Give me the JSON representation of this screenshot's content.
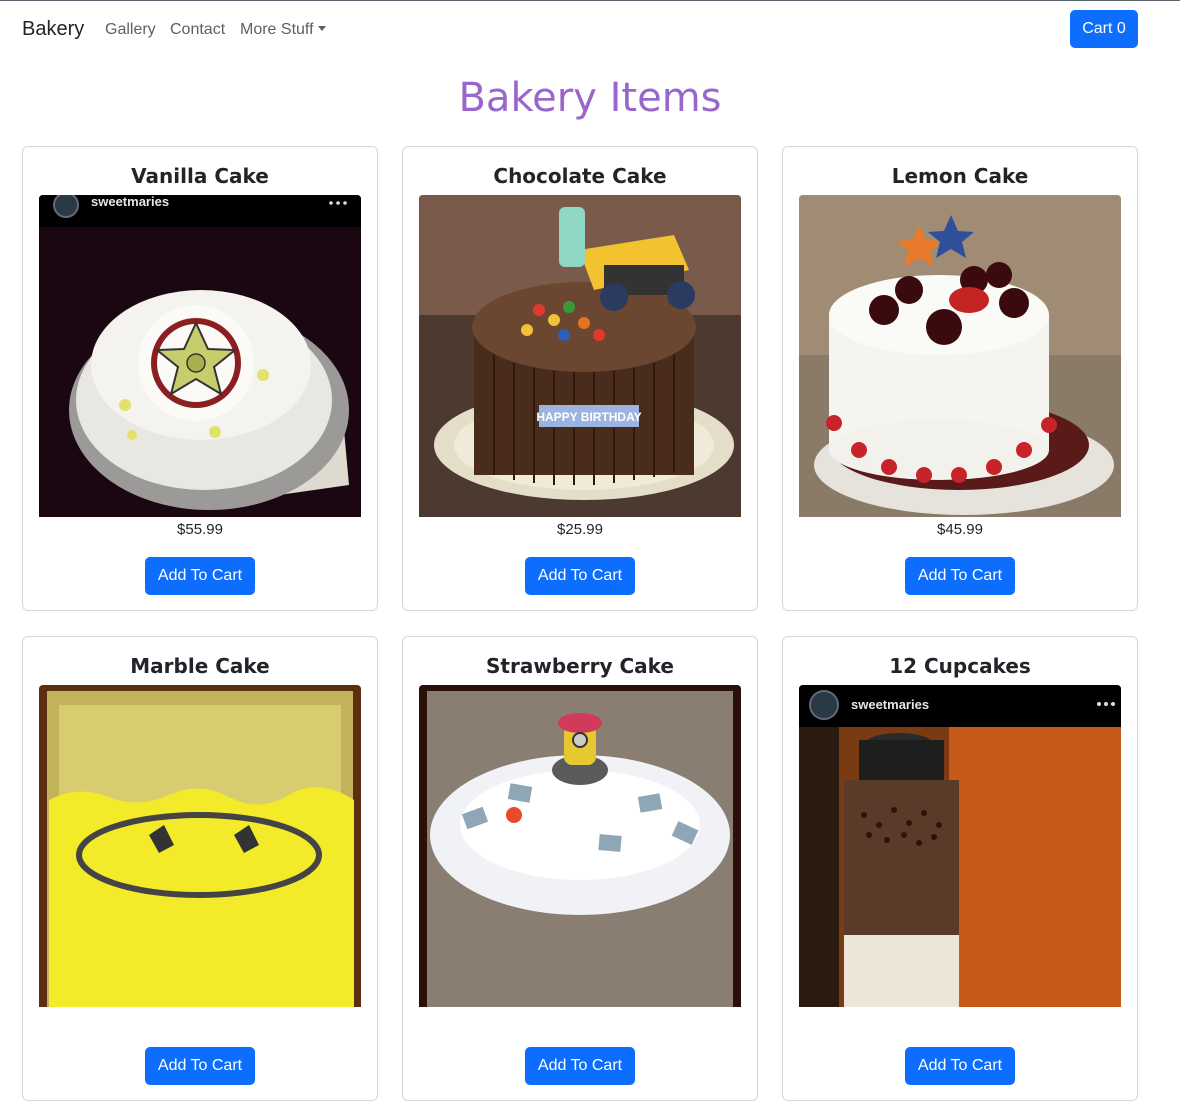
{
  "navbar": {
    "brand": "Bakery",
    "links": [
      "Gallery",
      "Contact"
    ],
    "dropdown_label": "More Stuff",
    "cart_label": "Cart 0"
  },
  "page": {
    "title": "Bakery Items",
    "title_color": "#9966cc",
    "accent_color": "#0d6efd"
  },
  "products": [
    {
      "name": "Vanilla Cake",
      "price": "$55.99",
      "button": "Add To Cart",
      "overlay_user": "sweetmaries"
    },
    {
      "name": "Chocolate Cake",
      "price": "$25.99",
      "button": "Add To Cart",
      "cake_text": "HAPPY BIRTHDAY"
    },
    {
      "name": "Lemon Cake",
      "price": "$45.99",
      "button": "Add To Cart"
    },
    {
      "name": "Marble Cake",
      "price": "",
      "button": "Add To Cart"
    },
    {
      "name": "Strawberry Cake",
      "price": "",
      "button": "Add To Cart"
    },
    {
      "name": "12 Cupcakes",
      "price": "",
      "button": "Add To Cart",
      "overlay_user": "sweetmaries"
    }
  ]
}
